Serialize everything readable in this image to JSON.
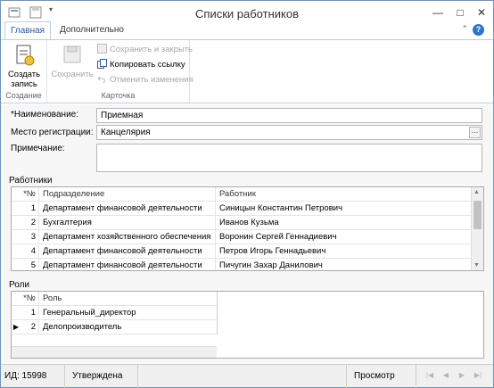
{
  "window": {
    "title": "Списки работников"
  },
  "ribbon": {
    "tabs": [
      "Главная",
      "Дополнительно"
    ],
    "groups": {
      "create": {
        "label": "Создание",
        "create_btn": [
          "Создать",
          "запись"
        ]
      },
      "card": {
        "label": "Карточка",
        "save": "Сохранить",
        "save_close": "Сохранить и закрыть",
        "copy_link": "Копировать ссылку",
        "undo": "Отменить изменения"
      }
    }
  },
  "form": {
    "name_label": "*Наименование:",
    "name_value": "Приемная",
    "place_label": "Место регистрации:",
    "place_value": "Канцелярия",
    "note_label": "Примечание:",
    "note_value": ""
  },
  "workers": {
    "section_label": "Работники",
    "headers": [
      "*№",
      "Подразделение",
      "Работник"
    ],
    "rows": [
      {
        "n": "1",
        "dept": "Департамент финансовой деятельности",
        "worker": "Синицын Константин Петрович"
      },
      {
        "n": "2",
        "dept": "Бухгалтерия",
        "worker": "Иванов Кузьма"
      },
      {
        "n": "3",
        "dept": "Департамент хозяйственного обеспечения",
        "worker": "Воронин Сергей Геннадиевич"
      },
      {
        "n": "4",
        "dept": "Департамент финансовой деятельности",
        "worker": "Петров Игорь Геннадьевич"
      },
      {
        "n": "5",
        "dept": "Департамент финансовой деятельности",
        "worker": "Пичугин Захар Данилович"
      }
    ]
  },
  "roles": {
    "section_label": "Роли",
    "headers": [
      "*№",
      "Роль"
    ],
    "rows": [
      {
        "n": "1",
        "role": "Генеральный_директор"
      },
      {
        "n": "2",
        "role": "Делопроизводитель"
      }
    ]
  },
  "status": {
    "id": "ИД: 15998",
    "state": "Утверждена",
    "mode": "Просмотр"
  },
  "colors": {
    "accent": "#2b579a",
    "border": "#6e95b9"
  }
}
